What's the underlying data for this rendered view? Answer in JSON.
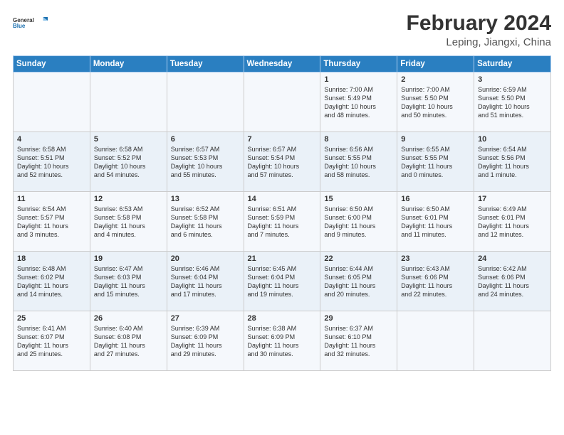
{
  "logo": {
    "line1": "General",
    "line2": "Blue"
  },
  "title": "February 2024",
  "subtitle": "Leping, Jiangxi, China",
  "columns": [
    "Sunday",
    "Monday",
    "Tuesday",
    "Wednesday",
    "Thursday",
    "Friday",
    "Saturday"
  ],
  "weeks": [
    [
      {
        "day": "",
        "info": ""
      },
      {
        "day": "",
        "info": ""
      },
      {
        "day": "",
        "info": ""
      },
      {
        "day": "",
        "info": ""
      },
      {
        "day": "1",
        "info": "Sunrise: 7:00 AM\nSunset: 5:49 PM\nDaylight: 10 hours\nand 48 minutes."
      },
      {
        "day": "2",
        "info": "Sunrise: 7:00 AM\nSunset: 5:50 PM\nDaylight: 10 hours\nand 50 minutes."
      },
      {
        "day": "3",
        "info": "Sunrise: 6:59 AM\nSunset: 5:50 PM\nDaylight: 10 hours\nand 51 minutes."
      }
    ],
    [
      {
        "day": "4",
        "info": "Sunrise: 6:58 AM\nSunset: 5:51 PM\nDaylight: 10 hours\nand 52 minutes."
      },
      {
        "day": "5",
        "info": "Sunrise: 6:58 AM\nSunset: 5:52 PM\nDaylight: 10 hours\nand 54 minutes."
      },
      {
        "day": "6",
        "info": "Sunrise: 6:57 AM\nSunset: 5:53 PM\nDaylight: 10 hours\nand 55 minutes."
      },
      {
        "day": "7",
        "info": "Sunrise: 6:57 AM\nSunset: 5:54 PM\nDaylight: 10 hours\nand 57 minutes."
      },
      {
        "day": "8",
        "info": "Sunrise: 6:56 AM\nSunset: 5:55 PM\nDaylight: 10 hours\nand 58 minutes."
      },
      {
        "day": "9",
        "info": "Sunrise: 6:55 AM\nSunset: 5:55 PM\nDaylight: 11 hours\nand 0 minutes."
      },
      {
        "day": "10",
        "info": "Sunrise: 6:54 AM\nSunset: 5:56 PM\nDaylight: 11 hours\nand 1 minute."
      }
    ],
    [
      {
        "day": "11",
        "info": "Sunrise: 6:54 AM\nSunset: 5:57 PM\nDaylight: 11 hours\nand 3 minutes."
      },
      {
        "day": "12",
        "info": "Sunrise: 6:53 AM\nSunset: 5:58 PM\nDaylight: 11 hours\nand 4 minutes."
      },
      {
        "day": "13",
        "info": "Sunrise: 6:52 AM\nSunset: 5:58 PM\nDaylight: 11 hours\nand 6 minutes."
      },
      {
        "day": "14",
        "info": "Sunrise: 6:51 AM\nSunset: 5:59 PM\nDaylight: 11 hours\nand 7 minutes."
      },
      {
        "day": "15",
        "info": "Sunrise: 6:50 AM\nSunset: 6:00 PM\nDaylight: 11 hours\nand 9 minutes."
      },
      {
        "day": "16",
        "info": "Sunrise: 6:50 AM\nSunset: 6:01 PM\nDaylight: 11 hours\nand 11 minutes."
      },
      {
        "day": "17",
        "info": "Sunrise: 6:49 AM\nSunset: 6:01 PM\nDaylight: 11 hours\nand 12 minutes."
      }
    ],
    [
      {
        "day": "18",
        "info": "Sunrise: 6:48 AM\nSunset: 6:02 PM\nDaylight: 11 hours\nand 14 minutes."
      },
      {
        "day": "19",
        "info": "Sunrise: 6:47 AM\nSunset: 6:03 PM\nDaylight: 11 hours\nand 15 minutes."
      },
      {
        "day": "20",
        "info": "Sunrise: 6:46 AM\nSunset: 6:04 PM\nDaylight: 11 hours\nand 17 minutes."
      },
      {
        "day": "21",
        "info": "Sunrise: 6:45 AM\nSunset: 6:04 PM\nDaylight: 11 hours\nand 19 minutes."
      },
      {
        "day": "22",
        "info": "Sunrise: 6:44 AM\nSunset: 6:05 PM\nDaylight: 11 hours\nand 20 minutes."
      },
      {
        "day": "23",
        "info": "Sunrise: 6:43 AM\nSunset: 6:06 PM\nDaylight: 11 hours\nand 22 minutes."
      },
      {
        "day": "24",
        "info": "Sunrise: 6:42 AM\nSunset: 6:06 PM\nDaylight: 11 hours\nand 24 minutes."
      }
    ],
    [
      {
        "day": "25",
        "info": "Sunrise: 6:41 AM\nSunset: 6:07 PM\nDaylight: 11 hours\nand 25 minutes."
      },
      {
        "day": "26",
        "info": "Sunrise: 6:40 AM\nSunset: 6:08 PM\nDaylight: 11 hours\nand 27 minutes."
      },
      {
        "day": "27",
        "info": "Sunrise: 6:39 AM\nSunset: 6:09 PM\nDaylight: 11 hours\nand 29 minutes."
      },
      {
        "day": "28",
        "info": "Sunrise: 6:38 AM\nSunset: 6:09 PM\nDaylight: 11 hours\nand 30 minutes."
      },
      {
        "day": "29",
        "info": "Sunrise: 6:37 AM\nSunset: 6:10 PM\nDaylight: 11 hours\nand 32 minutes."
      },
      {
        "day": "",
        "info": ""
      },
      {
        "day": "",
        "info": ""
      }
    ]
  ]
}
